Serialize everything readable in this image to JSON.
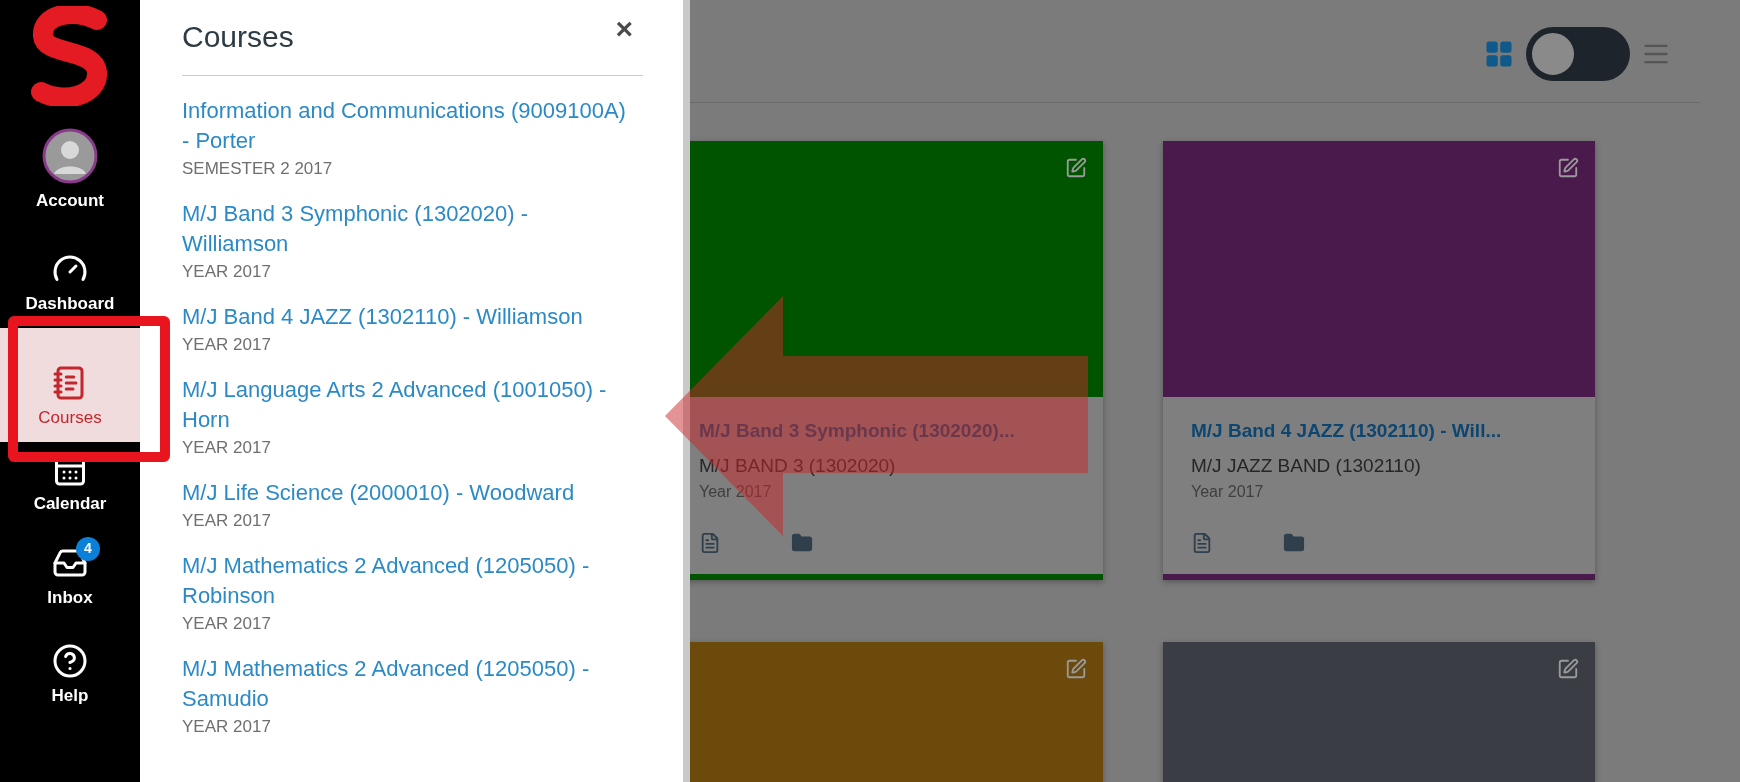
{
  "nav": [
    {
      "kind": "account",
      "label": "Account",
      "selected": false
    },
    {
      "kind": "dashboard",
      "label": "Dashboard",
      "selected": false
    },
    {
      "kind": "courses",
      "label": "Courses",
      "selected": true
    },
    {
      "kind": "calendar",
      "label": "Calendar",
      "selected": false
    },
    {
      "kind": "inbox",
      "label": "Inbox",
      "selected": false,
      "badge": "4"
    },
    {
      "kind": "help",
      "label": "Help",
      "selected": false
    }
  ],
  "courses_panel": {
    "title": "Courses",
    "close": "×",
    "courses": [
      {
        "name": "Information and Communications (9009100A) - Porter",
        "term": "SEMESTER 2 2017"
      },
      {
        "name": "M/J Band 3 Symphonic (1302020) - Williamson",
        "term": "YEAR 2017"
      },
      {
        "name": "M/J Band 4 JAZZ (1302110) - Williamson",
        "term": "YEAR 2017"
      },
      {
        "name": "M/J Language Arts 2 Advanced (1001050) - Horn",
        "term": "YEAR 2017"
      },
      {
        "name": "M/J Life Science (2000010) - Woodward",
        "term": "YEAR 2017"
      },
      {
        "name": "M/J Mathematics 2 Advanced (1205050) - Robinson",
        "term": "YEAR 2017"
      },
      {
        "name": "M/J Mathematics 2 Advanced (1205050) - Samudio",
        "term": "YEAR 2017"
      }
    ]
  },
  "view_toggle": {
    "grid_selected": true
  },
  "cards": [
    {
      "title": "M/J Band 3 Symphonic (1302020)...",
      "code": "M/J BAND 3 (1302020)",
      "term": "Year 2017",
      "color": "#005400"
    },
    {
      "title": "M/J Band 4 JAZZ (1302110) - Will...",
      "code": "M/J JAZZ BAND (1302110)",
      "term": "Year 2017",
      "color": "#4a1a4c"
    },
    {
      "color": "#6b4a0c"
    },
    {
      "color": "#3a3e44"
    }
  ]
}
